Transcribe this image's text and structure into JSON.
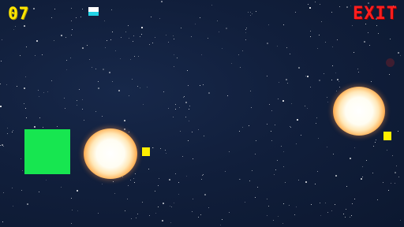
{
  "hud": {
    "score": "07",
    "exit_label": "EXIT"
  },
  "colors": {
    "background": "#0f1c36",
    "score": "#ffe600",
    "exit": "#ff1e1e",
    "player": "#17e650",
    "pickup": "#ffee00",
    "life_top": "#ffffff",
    "life_bottom": "#22d3e6"
  },
  "icons": {
    "life_indicator": "life-indicator-icon",
    "fireball": "fireball-icon",
    "pickup": "pickup-icon"
  }
}
